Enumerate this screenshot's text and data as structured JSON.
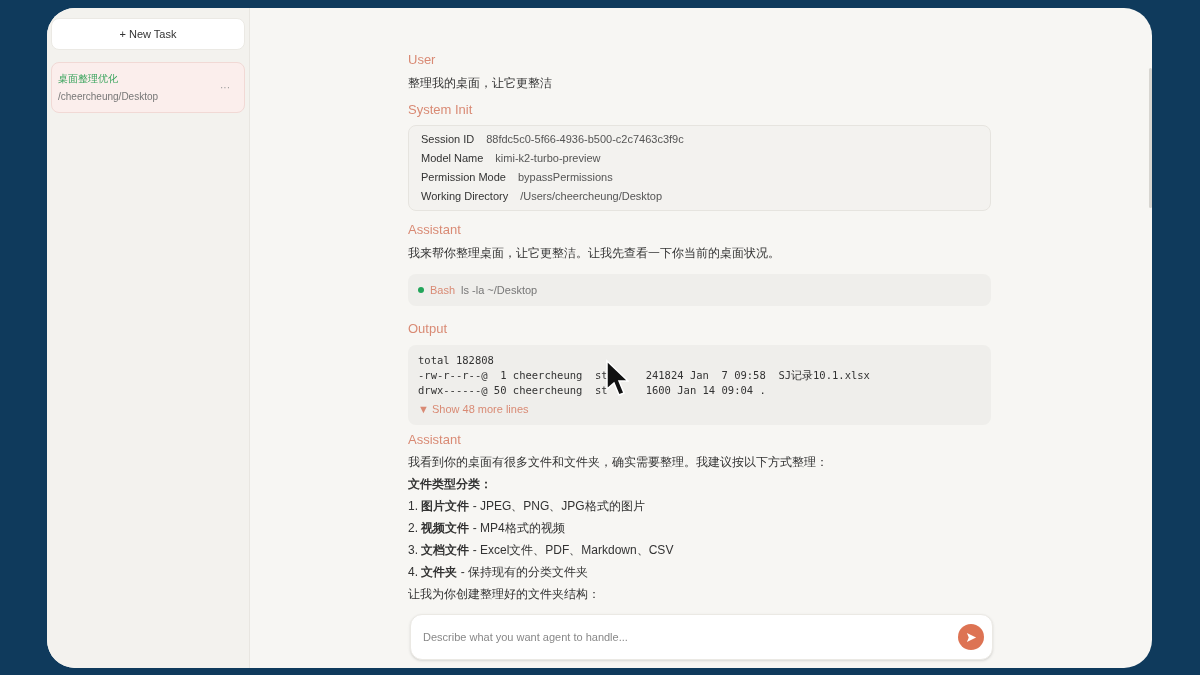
{
  "sidebar": {
    "new_task_button": "+ New Task",
    "tasks": [
      {
        "title": "桌面整理优化",
        "path": "/cheercheung/Desktop",
        "selected": true,
        "menu": "···"
      }
    ]
  },
  "messages": [
    {
      "kind": "text",
      "role": "User",
      "paragraphs": [
        "整理我的桌面，让它更整洁"
      ]
    },
    {
      "kind": "info",
      "role": "System Init",
      "rows": [
        {
          "label": "Session ID",
          "value": "88fdc5c0-5f66-4936-b500-c2c7463c3f9c"
        },
        {
          "label": "Model Name",
          "value": "kimi-k2-turbo-preview"
        },
        {
          "label": "Permission Mode",
          "value": "bypassPermissions"
        },
        {
          "label": "Working Directory",
          "value": "/Users/cheercheung/Desktop"
        }
      ]
    },
    {
      "kind": "text",
      "role": "Assistant",
      "paragraphs": [
        "我来帮你整理桌面，让它更整洁。让我先查看一下你当前的桌面状况。"
      ]
    },
    {
      "kind": "tool",
      "tool": "Bash",
      "command": "ls -la ~/Desktop",
      "color": "#22a55a"
    },
    {
      "kind": "output",
      "role": "Output",
      "lines": [
        {
          "left": "total 182808"
        },
        {
          "left": "-rw-r--r--@  1 cheercheung  st",
          "right": "241824 Jan  7 09:58  SJ记录10.1.xlsx"
        },
        {
          "left": "drwx------@ 50 cheercheung  st",
          "right": "1600 Jan 14 09:04 ."
        }
      ],
      "expand": "▼ Show 48 more lines"
    },
    {
      "kind": "text",
      "role": "Assistant",
      "paragraphs": [
        "我看到你的桌面有很多文件和文件夹，确实需要整理。我建议按以下方式整理：",
        "**文件类型分类：**",
        "1. **图片文件** - JPEG、PNG、JPG格式的图片",
        "2. **视频文件** - MP4格式的视频",
        "3. **文档文件** - Excel文件、PDF、Markdown、CSV",
        "4. **文件夹** - 保持现有的分类文件夹",
        "让我为你创建整理好的文件夹结构："
      ]
    }
  ],
  "composer": {
    "placeholder": "Describe what you want agent to handle..."
  }
}
